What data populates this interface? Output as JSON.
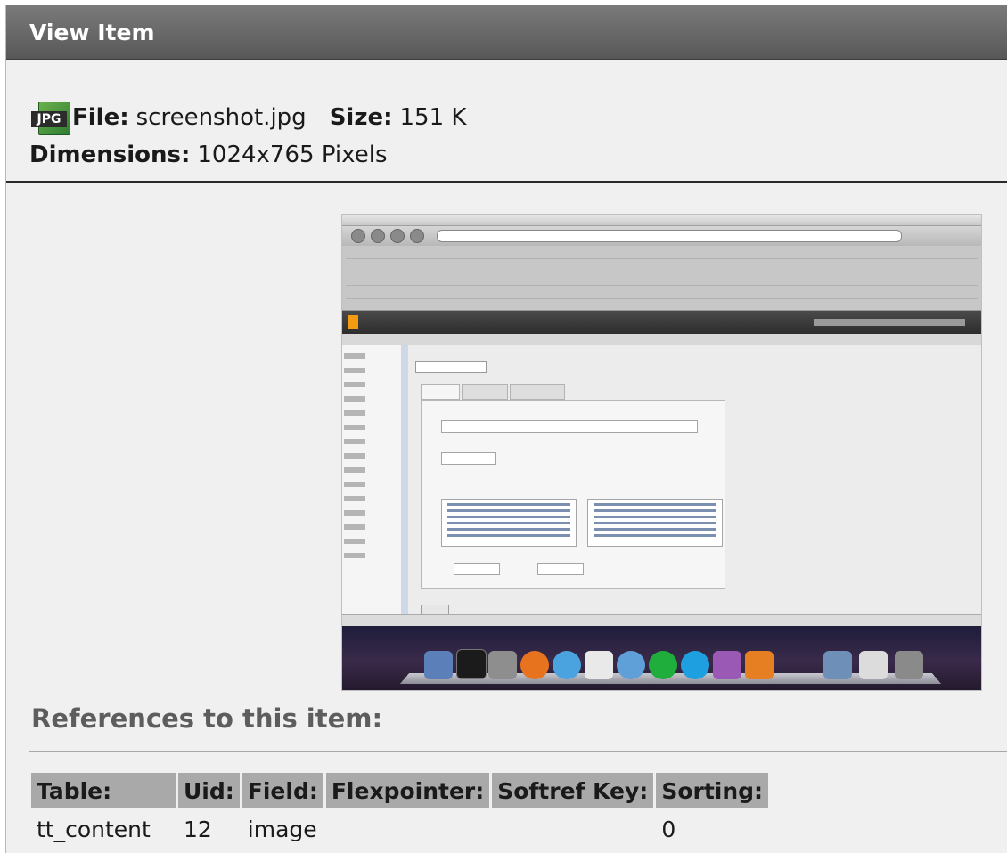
{
  "header": {
    "title": "View Item"
  },
  "file_info": {
    "icon": "jpg-file-icon",
    "icon_label": "JPG",
    "file_label": "File:",
    "file_value": "screenshot.jpg",
    "size_label": "Size:",
    "size_value": "151 K",
    "dimensions_label": "Dimensions:",
    "dimensions_value": "1024x765 Pixels"
  },
  "preview": {
    "image": "screenshot-thumbnail"
  },
  "references": {
    "title": "References to this item:",
    "columns": [
      "Table:",
      "Uid:",
      "Field:",
      "Flexpointer:",
      "Softref Key:",
      "Sorting:"
    ],
    "rows": [
      [
        "tt_content",
        "12",
        "image",
        "",
        "",
        "0"
      ]
    ]
  },
  "colors": {
    "header_bg": "#686868",
    "page_bg": "#f0f0f0",
    "table_header_bg": "#a9a9a9",
    "section_title": "#5d5d5d"
  }
}
